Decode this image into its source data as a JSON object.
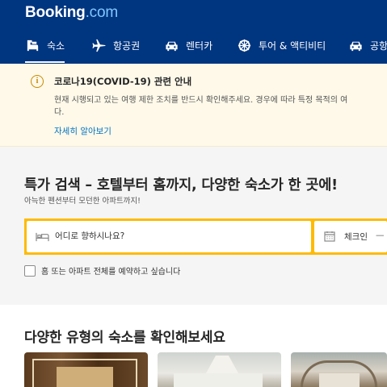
{
  "header": {
    "logo_main": "Booking",
    "logo_suffix": ".com",
    "nav": [
      {
        "label": "숙소",
        "icon": "bed-icon",
        "active": true
      },
      {
        "label": "항공권",
        "icon": "plane-icon",
        "active": false
      },
      {
        "label": "렌터카",
        "icon": "car-icon",
        "active": false
      },
      {
        "label": "투어 & 액티비티",
        "icon": "attractions-icon",
        "active": false
      },
      {
        "label": "공항",
        "icon": "taxi-icon",
        "active": false
      }
    ]
  },
  "alert": {
    "icon": "info-icon",
    "title": "코로나19(COVID-19) 관련 안내",
    "body_line1": "현재 시행되고 있는 여행 제한 조치를 반드시 확인해주세요. 경우에 따라 특정 목적의 여",
    "body_line2": "다.",
    "link": "자세히 알아보기"
  },
  "search": {
    "title": "특가 검색 – 호텔부터 홈까지, 다양한 숙소가 한 곳에!",
    "subtitle": "아늑한 펜션부터 모던한 아파트까지!",
    "destination_placeholder": "어디로 향하시나요?",
    "checkin_label": "체크인",
    "checkin_dash": "—",
    "entire_home_label": "홈 또는 아파트 전체를 예약하고 싶습니다"
  },
  "property_types": {
    "title": "다양한 유형의 숙소를 확인해보세요"
  },
  "colors": {
    "brand_blue": "#003580",
    "search_yellow": "#febb02",
    "link_blue": "#0071c2",
    "alert_bg": "#fef9e9"
  }
}
